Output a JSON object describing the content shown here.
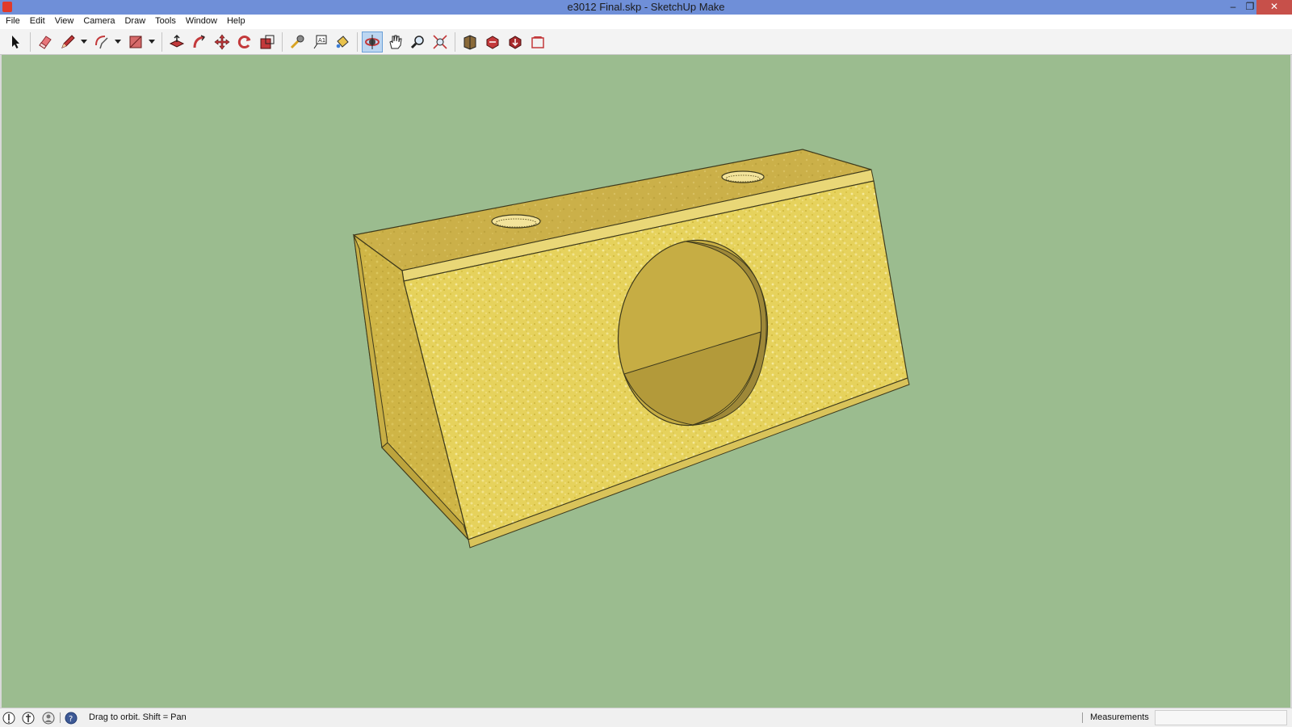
{
  "window": {
    "title": "e3012 Final.skp - SketchUp Make",
    "app_icon": "sketchup-logo-icon",
    "controls": {
      "minimize": "–",
      "restore": "❐",
      "close": "✕"
    }
  },
  "menu": {
    "items": [
      "File",
      "Edit",
      "View",
      "Camera",
      "Draw",
      "Tools",
      "Window",
      "Help"
    ]
  },
  "toolbar": {
    "tools": [
      {
        "name": "select",
        "icon": "arrow-cursor-icon"
      },
      {
        "name": "eraser",
        "icon": "eraser-icon"
      },
      {
        "name": "line",
        "icon": "pencil-icon"
      },
      {
        "name": "arc",
        "icon": "arc-icon"
      },
      {
        "name": "rectangle",
        "icon": "rectangle-icon"
      },
      {
        "name": "push-pull",
        "icon": "push-pull-icon"
      },
      {
        "name": "follow-me",
        "icon": "follow-me-icon"
      },
      {
        "name": "move",
        "icon": "move-icon"
      },
      {
        "name": "rotate",
        "icon": "rotate-icon"
      },
      {
        "name": "scale",
        "icon": "scale-icon"
      },
      {
        "name": "tape-measure",
        "icon": "tape-measure-icon"
      },
      {
        "name": "text",
        "icon": "text-icon"
      },
      {
        "name": "paint-bucket",
        "icon": "paint-bucket-icon"
      },
      {
        "name": "orbit",
        "icon": "orbit-icon",
        "active": true
      },
      {
        "name": "pan",
        "icon": "pan-hand-icon"
      },
      {
        "name": "zoom",
        "icon": "zoom-icon"
      },
      {
        "name": "zoom-extents",
        "icon": "zoom-extents-icon"
      },
      {
        "name": "warehouse",
        "icon": "3d-warehouse-icon"
      },
      {
        "name": "share-model",
        "icon": "share-model-icon"
      },
      {
        "name": "get-models",
        "icon": "get-models-icon"
      },
      {
        "name": "extension-warehouse",
        "icon": "extension-warehouse-icon"
      }
    ]
  },
  "viewport": {
    "background_color": "#9bbc8f",
    "model_color": "#e4cf59",
    "model_description_icon": "subwoofer-box-model"
  },
  "status": {
    "hint": "Drag to orbit.  Shift = Pan",
    "measurements_label": "Measurements",
    "measurements_value": "",
    "icons": [
      "geo-location-icon",
      "credits-icon",
      "user-icon",
      "help-icon"
    ]
  },
  "colors": {
    "titlebar": "#6f8fd8",
    "close_button": "#c7504a",
    "active_tool": "#bcd6f1"
  }
}
